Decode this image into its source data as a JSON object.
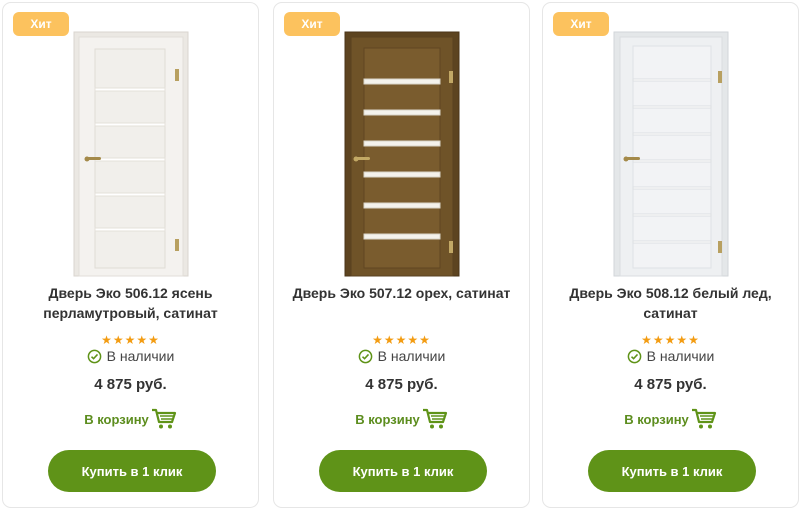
{
  "products": [
    {
      "badge": "Хит",
      "title": "Дверь Эко 506.12 ясень перламутровый, сатинат",
      "rating_stars": "★★★★★",
      "rating": 5,
      "stock": "В наличии",
      "price": "4 875 руб.",
      "cart_label": "В корзину",
      "buy_label": "Купить в 1 клик",
      "door_color": "#f3f1ee",
      "glass_color": "#ffffff",
      "icon": "door-image"
    },
    {
      "badge": "Хит",
      "title": "Дверь Эко 507.12 орех, сатинат",
      "rating_stars": "★★★★★",
      "rating": 5,
      "stock": "В наличии",
      "price": "4 875 руб.",
      "cart_label": "В корзину",
      "buy_label": "Купить в 1 клик",
      "door_color": "#6e5227",
      "glass_color": "#f2f0ea",
      "icon": "door-image"
    },
    {
      "badge": "Хит",
      "title": "Дверь Эко 508.12 белый лед, сатинат",
      "rating_stars": "★★★★★",
      "rating": 5,
      "stock": "В наличии",
      "price": "4 875 руб.",
      "cart_label": "В корзину",
      "buy_label": "Купить в 1 клик",
      "door_color": "#eef0f1",
      "glass_color": "#ffffff",
      "icon": "door-image"
    }
  ],
  "colors": {
    "badge": "#fcc25e",
    "button": "#5f9318",
    "cart_text": "#5c8d1e",
    "stars": "#f39c12"
  }
}
